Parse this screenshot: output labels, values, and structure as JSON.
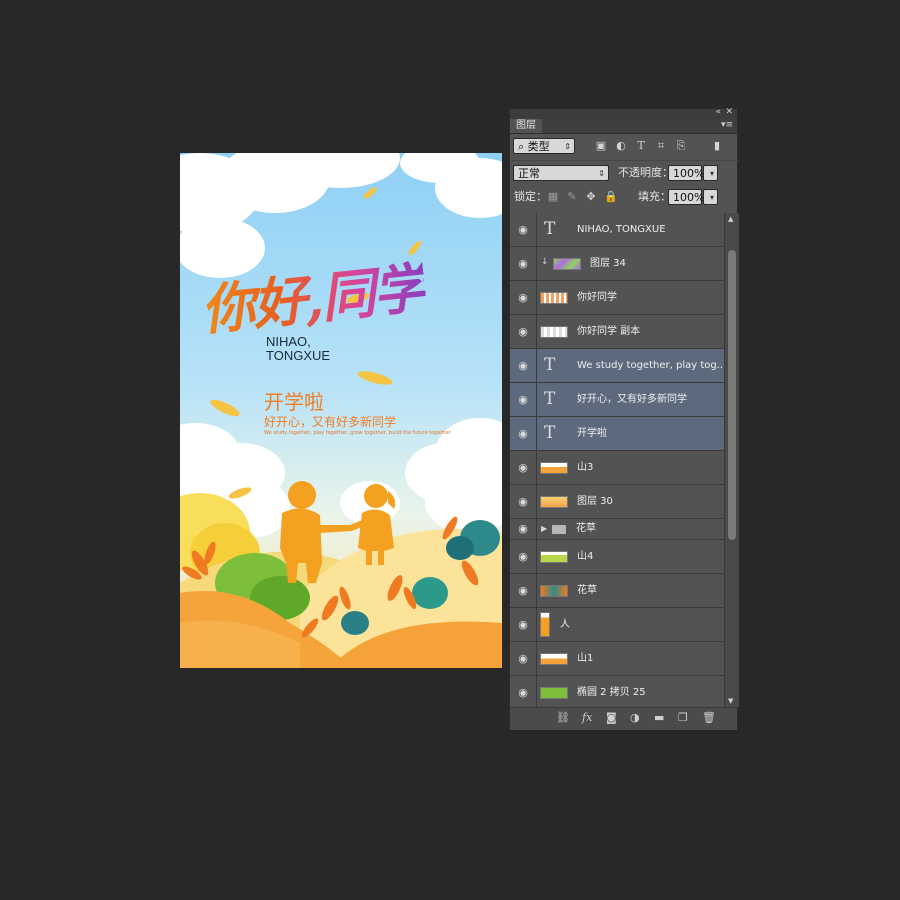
{
  "poster": {
    "title_cn": "你好,同学",
    "title_en_line1": "NIHAO,",
    "title_en_line2": "TONGXUE",
    "subtitle": "开学啦",
    "tagline": "好开心，又有好多新同学",
    "small_text": "We study together, play together, grow together, build the future together"
  },
  "layers_panel": {
    "tab_label": "图层",
    "collapse_icon": "double-chevron-icon",
    "close_icon": "close-icon",
    "menu_icon": "panel-menu-icon",
    "filter": {
      "label": "类型",
      "search_icon": "search-icon"
    },
    "filter_icons": [
      "image-filter-icon",
      "adjustment-filter-icon",
      "type-filter-icon",
      "shape-filter-icon",
      "smart-object-filter-icon",
      "toggle-filter-icon"
    ],
    "blend_mode": "正常",
    "opacity_label": "不透明度：",
    "opacity_value": "100%",
    "lock_label": "锁定：",
    "fill_label": "填充：",
    "fill_value": "100%",
    "layers": [
      {
        "name": "NIHAO, TONGXUE",
        "kind": "text",
        "selected": false
      },
      {
        "name": "图层 34",
        "kind": "clipped",
        "selected": false
      },
      {
        "name": "你好同学",
        "kind": "image",
        "selected": false
      },
      {
        "name": "你好同学 副本",
        "kind": "image",
        "selected": false
      },
      {
        "name": "We study together, play tog...",
        "kind": "text",
        "selected": true
      },
      {
        "name": "好开心，又有好多新同学",
        "kind": "text",
        "selected": true
      },
      {
        "name": "开学啦",
        "kind": "text",
        "selected": true
      },
      {
        "name": "山3",
        "kind": "image",
        "selected": false
      },
      {
        "name": "图层 30",
        "kind": "image",
        "selected": false
      },
      {
        "name": "花草",
        "kind": "folder",
        "selected": false
      },
      {
        "name": "山4",
        "kind": "image",
        "selected": false
      },
      {
        "name": "花草",
        "kind": "image",
        "selected": false
      },
      {
        "name": "人",
        "kind": "image",
        "selected": false
      },
      {
        "name": "山1",
        "kind": "image",
        "selected": false
      },
      {
        "name": "椭圆 2 拷贝 25",
        "kind": "image",
        "selected": false
      }
    ],
    "bottom_icons": [
      "link-layers-icon",
      "fx-icon",
      "add-mask-icon",
      "new-adjustment-icon",
      "new-group-icon",
      "new-layer-icon",
      "delete-layer-icon"
    ]
  }
}
